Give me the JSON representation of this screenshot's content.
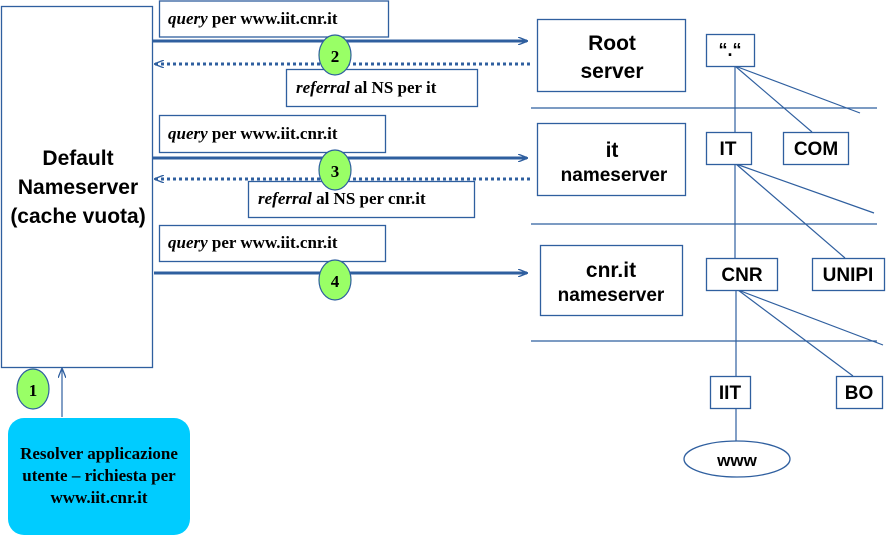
{
  "default_ns": {
    "line1": "Default",
    "line2": "Nameserver",
    "line3": "(cache vuota)"
  },
  "resolver": {
    "line1": "Resolver applicazione",
    "line2": "utente – richiesta per",
    "line3": "www.iit.cnr.it"
  },
  "steps": [
    "1",
    "2",
    "3",
    "4"
  ],
  "queries": [
    {
      "em": "query",
      "text": " per www.iit.cnr.it"
    },
    {
      "em": "query",
      "text": " per www.iit.cnr.it"
    },
    {
      "em": "query",
      "text": " per www.iit.cnr.it"
    }
  ],
  "referrals": [
    {
      "em": "referral",
      "text": " al NS per it"
    },
    {
      "em": "referral",
      "text": " al NS per cnr.it"
    }
  ],
  "servers": [
    {
      "line1": "Root",
      "line2": "server"
    },
    {
      "line1": "it",
      "line2": "nameserver"
    },
    {
      "line1": "cnr.it",
      "line2": "nameserver"
    }
  ],
  "tree": {
    "root": "“.“",
    "it": "IT",
    "com": "COM",
    "cnr": "CNR",
    "unipi": "UNIPI",
    "iit": "IIT",
    "bo": "BO",
    "www": "www"
  },
  "colors": {
    "line": "#2f5f9f",
    "step_circle": "#99ff66",
    "resolver_bg": "#00ccff"
  }
}
